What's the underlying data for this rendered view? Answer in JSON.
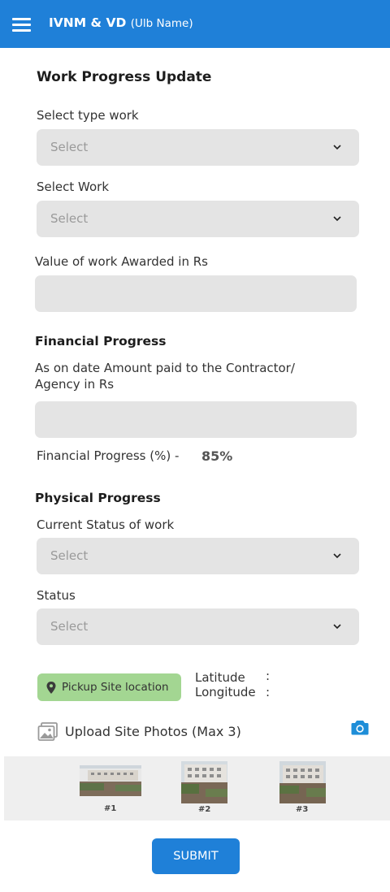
{
  "header": {
    "title": "IVNM & VD",
    "subtitle": "(Ulb Name)"
  },
  "form": {
    "title": "Work Progress Update",
    "type_work": {
      "label": "Select type work",
      "placeholder": "Select"
    },
    "work": {
      "label": "Select Work",
      "placeholder": "Select"
    },
    "value_awarded": {
      "label": "Value of work Awarded in Rs",
      "value": ""
    },
    "financial": {
      "section_title": "Financial Progress",
      "amount_label_line1": "As on date Amount paid to the Contractor/",
      "amount_label_line2": "Agency in Rs",
      "amount_value": "",
      "percent_label": "Financial Progress (%) -",
      "percent_value": "85%"
    },
    "physical": {
      "section_title": "Physical Progress",
      "current_status": {
        "label": "Current Status of work",
        "placeholder": "Select"
      },
      "status": {
        "label": "Status",
        "placeholder": "Select"
      }
    },
    "location": {
      "button_label": "Pickup Site location",
      "latitude_label": "Latitude",
      "longitude_label": "Longitude",
      "separator": ":"
    },
    "photos": {
      "label": "Upload Site Photos (Max 3)",
      "items": [
        {
          "caption": "#1"
        },
        {
          "caption": "#2"
        },
        {
          "caption": "#3"
        }
      ]
    },
    "submit_label": "SUBMIT"
  },
  "icons": {
    "menu": "hamburger-menu-icon",
    "chevron": "chevron-down-icon",
    "pin": "location-pin-icon",
    "gallery": "image-gallery-icon",
    "camera": "camera-icon"
  },
  "colors": {
    "primary": "#1f80d8",
    "field_bg": "#e4e4e4",
    "location_button": "#a3d692",
    "photo_strip_bg": "#efefef"
  }
}
